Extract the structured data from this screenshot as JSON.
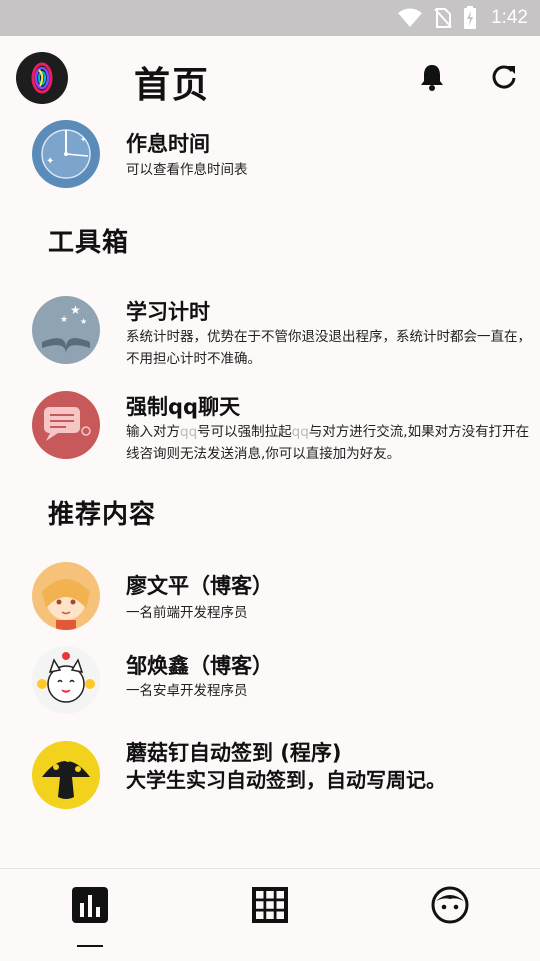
{
  "status_bar": {
    "time": "1:42"
  },
  "header": {
    "title": "首页"
  },
  "items_top": [
    {
      "name": "作息时间",
      "desc": "可以查看作息时间表"
    }
  ],
  "sections": {
    "tools": "工具箱",
    "recommend": "推荐内容"
  },
  "tools": [
    {
      "name": "学习计时",
      "desc": "系统计时器，优势在于不管你退没退出程序，系统计时都会一直在，不用担心计时不准确。"
    },
    {
      "name": "强制qq聊天",
      "desc_a": "输入对方",
      "desc_qq1": "qq",
      "desc_b": "号可以强制拉起",
      "desc_qq2": "qq",
      "desc_c": "与对方进行交流,如果对方没有打开在线咨询则无法发送消息,你可以直接加为好友。"
    }
  ],
  "recommend": [
    {
      "name": "廖文平（博客）",
      "desc": "一名前端开发程序员"
    },
    {
      "name": "邹焕鑫（博客）",
      "desc": "一名安卓开发程序员"
    },
    {
      "name": "蘑菇钉自动签到 (程序)",
      "desc": "大学生实习自动签到，自动写周记。"
    }
  ],
  "icons": {
    "wifi": "wifi-icon",
    "no_sim": "no-sim-icon",
    "battery": "battery-charging-icon",
    "bell": "bell-icon",
    "refresh": "refresh-icon",
    "tab_home": "bar-chart-icon",
    "tab_grid": "grid-icon",
    "tab_profile": "face-icon"
  },
  "colors": {
    "background": "#fcf9f8",
    "statusbar": "#c6c4c4",
    "clock_blue": "#5b8bb8",
    "qq_red": "#c8595b",
    "mushroom_yellow": "#f2d21c"
  }
}
